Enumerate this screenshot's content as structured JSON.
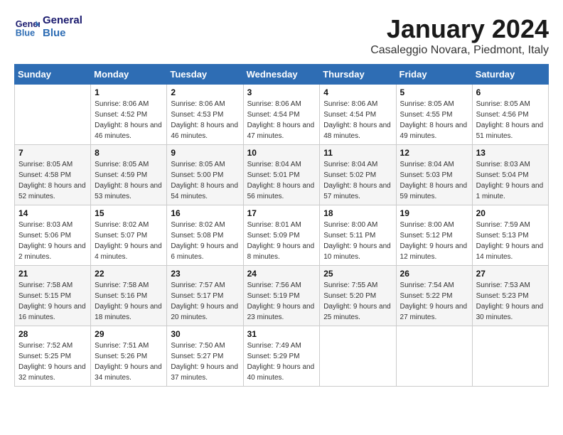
{
  "header": {
    "logo_line1": "General",
    "logo_line2": "Blue",
    "month": "January 2024",
    "location": "Casaleggio Novara, Piedmont, Italy"
  },
  "weekdays": [
    "Sunday",
    "Monday",
    "Tuesday",
    "Wednesday",
    "Thursday",
    "Friday",
    "Saturday"
  ],
  "weeks": [
    [
      {
        "day": "",
        "sunrise": "",
        "sunset": "",
        "daylight": ""
      },
      {
        "day": "1",
        "sunrise": "Sunrise: 8:06 AM",
        "sunset": "Sunset: 4:52 PM",
        "daylight": "Daylight: 8 hours and 46 minutes."
      },
      {
        "day": "2",
        "sunrise": "Sunrise: 8:06 AM",
        "sunset": "Sunset: 4:53 PM",
        "daylight": "Daylight: 8 hours and 46 minutes."
      },
      {
        "day": "3",
        "sunrise": "Sunrise: 8:06 AM",
        "sunset": "Sunset: 4:54 PM",
        "daylight": "Daylight: 8 hours and 47 minutes."
      },
      {
        "day": "4",
        "sunrise": "Sunrise: 8:06 AM",
        "sunset": "Sunset: 4:54 PM",
        "daylight": "Daylight: 8 hours and 48 minutes."
      },
      {
        "day": "5",
        "sunrise": "Sunrise: 8:05 AM",
        "sunset": "Sunset: 4:55 PM",
        "daylight": "Daylight: 8 hours and 49 minutes."
      },
      {
        "day": "6",
        "sunrise": "Sunrise: 8:05 AM",
        "sunset": "Sunset: 4:56 PM",
        "daylight": "Daylight: 8 hours and 51 minutes."
      }
    ],
    [
      {
        "day": "7",
        "sunrise": "Sunrise: 8:05 AM",
        "sunset": "Sunset: 4:58 PM",
        "daylight": "Daylight: 8 hours and 52 minutes."
      },
      {
        "day": "8",
        "sunrise": "Sunrise: 8:05 AM",
        "sunset": "Sunset: 4:59 PM",
        "daylight": "Daylight: 8 hours and 53 minutes."
      },
      {
        "day": "9",
        "sunrise": "Sunrise: 8:05 AM",
        "sunset": "Sunset: 5:00 PM",
        "daylight": "Daylight: 8 hours and 54 minutes."
      },
      {
        "day": "10",
        "sunrise": "Sunrise: 8:04 AM",
        "sunset": "Sunset: 5:01 PM",
        "daylight": "Daylight: 8 hours and 56 minutes."
      },
      {
        "day": "11",
        "sunrise": "Sunrise: 8:04 AM",
        "sunset": "Sunset: 5:02 PM",
        "daylight": "Daylight: 8 hours and 57 minutes."
      },
      {
        "day": "12",
        "sunrise": "Sunrise: 8:04 AM",
        "sunset": "Sunset: 5:03 PM",
        "daylight": "Daylight: 8 hours and 59 minutes."
      },
      {
        "day": "13",
        "sunrise": "Sunrise: 8:03 AM",
        "sunset": "Sunset: 5:04 PM",
        "daylight": "Daylight: 9 hours and 1 minute."
      }
    ],
    [
      {
        "day": "14",
        "sunrise": "Sunrise: 8:03 AM",
        "sunset": "Sunset: 5:06 PM",
        "daylight": "Daylight: 9 hours and 2 minutes."
      },
      {
        "day": "15",
        "sunrise": "Sunrise: 8:02 AM",
        "sunset": "Sunset: 5:07 PM",
        "daylight": "Daylight: 9 hours and 4 minutes."
      },
      {
        "day": "16",
        "sunrise": "Sunrise: 8:02 AM",
        "sunset": "Sunset: 5:08 PM",
        "daylight": "Daylight: 9 hours and 6 minutes."
      },
      {
        "day": "17",
        "sunrise": "Sunrise: 8:01 AM",
        "sunset": "Sunset: 5:09 PM",
        "daylight": "Daylight: 9 hours and 8 minutes."
      },
      {
        "day": "18",
        "sunrise": "Sunrise: 8:00 AM",
        "sunset": "Sunset: 5:11 PM",
        "daylight": "Daylight: 9 hours and 10 minutes."
      },
      {
        "day": "19",
        "sunrise": "Sunrise: 8:00 AM",
        "sunset": "Sunset: 5:12 PM",
        "daylight": "Daylight: 9 hours and 12 minutes."
      },
      {
        "day": "20",
        "sunrise": "Sunrise: 7:59 AM",
        "sunset": "Sunset: 5:13 PM",
        "daylight": "Daylight: 9 hours and 14 minutes."
      }
    ],
    [
      {
        "day": "21",
        "sunrise": "Sunrise: 7:58 AM",
        "sunset": "Sunset: 5:15 PM",
        "daylight": "Daylight: 9 hours and 16 minutes."
      },
      {
        "day": "22",
        "sunrise": "Sunrise: 7:58 AM",
        "sunset": "Sunset: 5:16 PM",
        "daylight": "Daylight: 9 hours and 18 minutes."
      },
      {
        "day": "23",
        "sunrise": "Sunrise: 7:57 AM",
        "sunset": "Sunset: 5:17 PM",
        "daylight": "Daylight: 9 hours and 20 minutes."
      },
      {
        "day": "24",
        "sunrise": "Sunrise: 7:56 AM",
        "sunset": "Sunset: 5:19 PM",
        "daylight": "Daylight: 9 hours and 23 minutes."
      },
      {
        "day": "25",
        "sunrise": "Sunrise: 7:55 AM",
        "sunset": "Sunset: 5:20 PM",
        "daylight": "Daylight: 9 hours and 25 minutes."
      },
      {
        "day": "26",
        "sunrise": "Sunrise: 7:54 AM",
        "sunset": "Sunset: 5:22 PM",
        "daylight": "Daylight: 9 hours and 27 minutes."
      },
      {
        "day": "27",
        "sunrise": "Sunrise: 7:53 AM",
        "sunset": "Sunset: 5:23 PM",
        "daylight": "Daylight: 9 hours and 30 minutes."
      }
    ],
    [
      {
        "day": "28",
        "sunrise": "Sunrise: 7:52 AM",
        "sunset": "Sunset: 5:25 PM",
        "daylight": "Daylight: 9 hours and 32 minutes."
      },
      {
        "day": "29",
        "sunrise": "Sunrise: 7:51 AM",
        "sunset": "Sunset: 5:26 PM",
        "daylight": "Daylight: 9 hours and 34 minutes."
      },
      {
        "day": "30",
        "sunrise": "Sunrise: 7:50 AM",
        "sunset": "Sunset: 5:27 PM",
        "daylight": "Daylight: 9 hours and 37 minutes."
      },
      {
        "day": "31",
        "sunrise": "Sunrise: 7:49 AM",
        "sunset": "Sunset: 5:29 PM",
        "daylight": "Daylight: 9 hours and 40 minutes."
      },
      {
        "day": "",
        "sunrise": "",
        "sunset": "",
        "daylight": ""
      },
      {
        "day": "",
        "sunrise": "",
        "sunset": "",
        "daylight": ""
      },
      {
        "day": "",
        "sunrise": "",
        "sunset": "",
        "daylight": ""
      }
    ]
  ]
}
